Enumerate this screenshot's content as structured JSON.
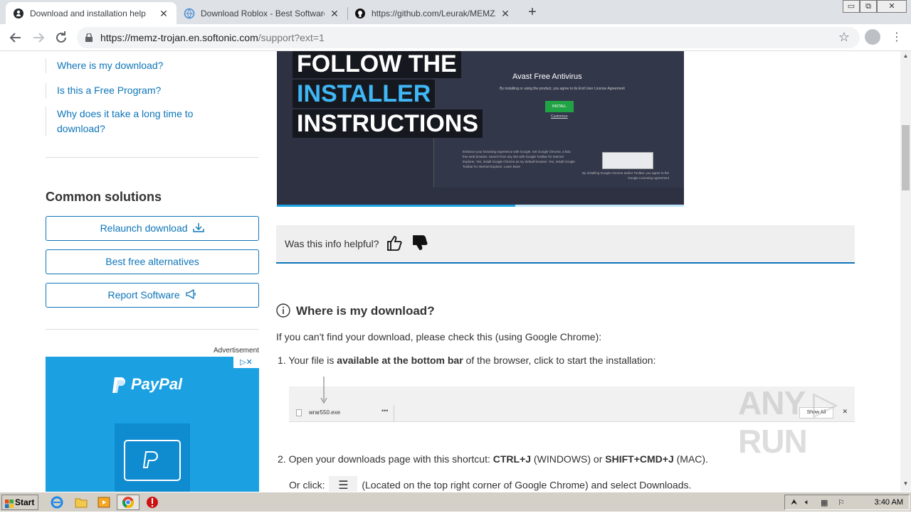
{
  "browser": {
    "tabs": [
      {
        "title": "Download and installation help",
        "favicon": "softonic-icon",
        "active": true
      },
      {
        "title": "Download Roblox - Best Software &",
        "favicon": "softonic-globe-icon",
        "active": false
      },
      {
        "title": "https://github.com/Leurak/MEMZ/ar",
        "favicon": "github-icon",
        "active": false
      }
    ],
    "new_tab": "+",
    "url_host": "https://memz-trojan.en.softonic.com",
    "url_path": "/support?ext=1",
    "window_controls": [
      "▭",
      "⧉",
      "✕"
    ]
  },
  "sidebar": {
    "links": [
      "Where is my download?",
      "Is this a Free Program?",
      "Why does it take a long time to download?"
    ],
    "common_title": "Common solutions",
    "buttons": [
      "Relaunch download",
      "Best free alternatives",
      "Report Software"
    ],
    "ad_label": "Advertisement",
    "ad_brand": "PayPal"
  },
  "hero": {
    "lines": [
      "FOLLOW THE",
      "INSTALLER",
      "INSTRUCTIONS"
    ],
    "dialog_title": "Avast Free Antivirus",
    "dialog_small": "By installing or using the product, you agree to its End User License Agreement",
    "install": "INSTALL",
    "customize": "Customize",
    "options": "Enhance your browsing experience with Google. Set Google Chrome, a fast, free web browser. Search from any site with Google Toolbar for Internet Explorer. Yes, install Google Chrome as my default browser. Yes, install Google Toolbar for Internet Explorer. Learn More",
    "legal": "By installing Google Chrome and/or Toolbar, you agree to the Google Licensing Agreement",
    "progress": 0.585
  },
  "feedback": {
    "question": "Was this info helpful?"
  },
  "section": {
    "title": "Where is my download?",
    "intro": "If you can't find your download, please check this (using Google Chrome):",
    "step1_pre": "Your file is ",
    "step1_bold": "available at the bottom bar",
    "step1_post": " of the browser, click to start the installation:",
    "dl_filename": "wrar550.exe",
    "dl_dots": "•••",
    "dl_showall": "Show All",
    "dl_close": "✕",
    "step2_pre": "Open your downloads page with this shortcut: ",
    "step2_k1": "CTRL+J",
    "step2_mid": " (WINDOWS) or ",
    "step2_k2": "SHIFT+CMD+J",
    "step2_post": " (MAC).",
    "step3_pre": "Or click: ",
    "step3_post": " (Located on the top right corner of Google Chrome) and select Downloads.",
    "num1": "1.",
    "num2": "2."
  },
  "watermark": "ANY ▷ RUN",
  "taskbar": {
    "start": "Start",
    "clock": "3:40 AM"
  }
}
